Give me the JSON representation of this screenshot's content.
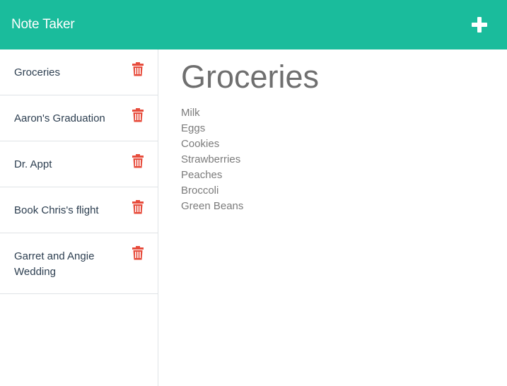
{
  "app": {
    "title": "Note Taker",
    "add_icon": "plus-icon",
    "accent_color": "#1abc9c",
    "delete_color": "#e74c3c"
  },
  "sidebar": {
    "notes": [
      {
        "title": "Groceries",
        "icon": "trash-icon"
      },
      {
        "title": "Aaron's Graduation",
        "icon": "trash-icon"
      },
      {
        "title": "Dr. Appt",
        "icon": "trash-icon"
      },
      {
        "title": "Book Chris's flight",
        "icon": "trash-icon"
      },
      {
        "title": "Garret and Angie Wedding",
        "icon": "trash-icon"
      }
    ]
  },
  "main": {
    "title": "Groceries",
    "lines": [
      "Milk",
      "Eggs",
      "Cookies",
      "Strawberries",
      "Peaches",
      "Broccoli",
      "Green Beans"
    ]
  }
}
